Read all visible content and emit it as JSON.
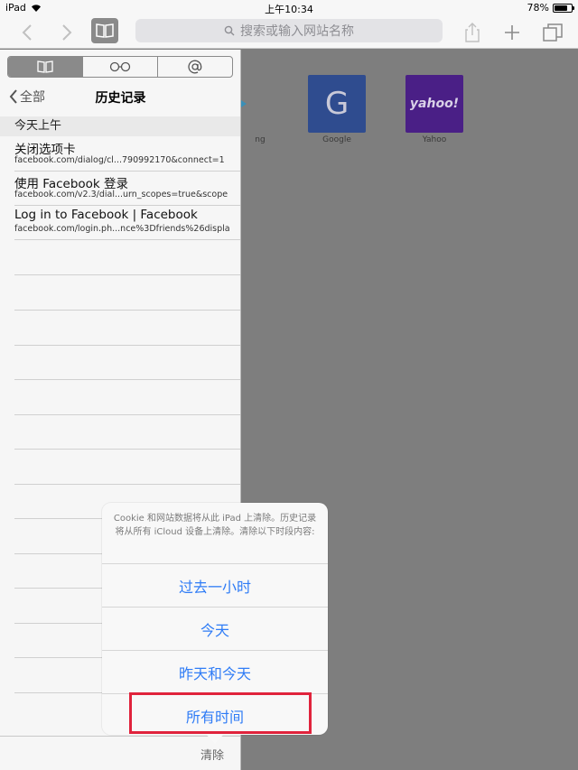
{
  "status_bar": {
    "device": "iPad",
    "time": "上午10:34",
    "battery": "78%",
    "battery_level": 0.78
  },
  "toolbar": {
    "address_placeholder": "搜索或输入网站名称"
  },
  "sidebar": {
    "tabs": [
      "bookmarks-icon",
      "reading-list-icon",
      "shared-links-icon"
    ],
    "back_label": "全部",
    "title": "历史记录",
    "section": "今天上午",
    "items": [
      {
        "title": "关闭选项卡",
        "url": "facebook.com/dialog/cl...790992170&connect=1"
      },
      {
        "title": "使用 Facebook 登录",
        "url": "facebook.com/v2.3/dial...urn_scopes=true&scope"
      },
      {
        "title": "Log in to Facebook | Facebook",
        "url": "facebook.com/login.ph...nce%3Dfriends%26displa"
      }
    ],
    "clear_label": "清除"
  },
  "favorites": [
    {
      "name": "ng",
      "letter": "",
      "color": "#8a8a8a"
    },
    {
      "name": "Google",
      "letter": "G",
      "color": "#2f4c8f"
    },
    {
      "name": "Yahoo",
      "letter": "yahoo!",
      "color": "#4a1f86"
    }
  ],
  "popover": {
    "message": "Cookie 和网站数据将从此 iPad 上清除。历史记录将从所有 iCloud 设备上清除。清除以下时段内容:",
    "options": [
      "过去一小时",
      "今天",
      "昨天和今天",
      "所有时间"
    ]
  }
}
